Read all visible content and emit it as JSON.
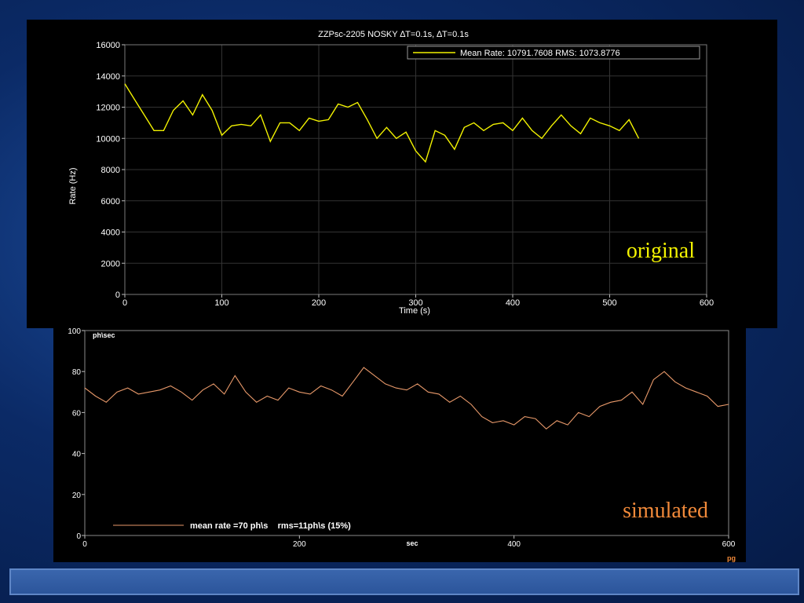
{
  "slide": {
    "background_color": "#0b2a66",
    "footer_bar_color": "#2c559b"
  },
  "chart_data": [
    {
      "type": "line",
      "title": "ZZPsc-2205 NOSKY ∆T=0.1s, ∆T=0.1s",
      "xlabel": "Time (s)",
      "ylabel": "Rate (Hz)",
      "xlim": [
        0,
        600
      ],
      "ylim": [
        0,
        16000
      ],
      "x_ticks": [
        0,
        100,
        200,
        300,
        400,
        500,
        600
      ],
      "y_ticks": [
        0,
        2000,
        4000,
        6000,
        8000,
        10000,
        12000,
        14000,
        16000
      ],
      "grid": true,
      "legend_position": "top-right",
      "legend": "Mean Rate: 10791.7608 RMS: 1073.8776",
      "annotation": "original",
      "line_color": "#f2f200",
      "annotation_color": "#f2f200",
      "series": [
        {
          "x": [
            0,
            10,
            20,
            30,
            40,
            50,
            60,
            70,
            80,
            90,
            100,
            110,
            120,
            130,
            140,
            150,
            160,
            170,
            180,
            190,
            200,
            210,
            220,
            230,
            240,
            250,
            260,
            270,
            280,
            290,
            300,
            310,
            320,
            330,
            340,
            350,
            360,
            370,
            380,
            390,
            400,
            410,
            420,
            430,
            440,
            450,
            460,
            470,
            480,
            490,
            500,
            510,
            520,
            530
          ],
          "values": [
            13500,
            12500,
            11500,
            10500,
            10500,
            11800,
            12400,
            11500,
            12800,
            11800,
            10200,
            10800,
            10900,
            10800,
            11500,
            9800,
            11000,
            11000,
            10500,
            11300,
            11100,
            11200,
            12200,
            12000,
            12300,
            11200,
            10000,
            10700,
            10000,
            10400,
            9200,
            8500,
            10500,
            10200,
            9300,
            10700,
            11000,
            10500,
            10900,
            11000,
            10500,
            11300,
            10500,
            10000,
            10800,
            11500,
            10800,
            10300,
            11300,
            11000,
            10800,
            10500,
            11200,
            10000
          ]
        }
      ]
    },
    {
      "type": "line",
      "title": "",
      "xlabel": "sec",
      "ylabel": "",
      "unit_label": "ph\\sec",
      "corner_label": "pg",
      "xlim": [
        0,
        600
      ],
      "ylim": [
        0,
        100
      ],
      "x_ticks": [
        0,
        200,
        400,
        600
      ],
      "y_ticks": [
        0,
        20,
        40,
        60,
        80,
        100
      ],
      "grid": false,
      "legend_position": "bottom-left",
      "legend": "mean rate =70 ph\\s    rms=11ph\\s (15%)",
      "annotation": "simulated",
      "line_color": "#e8996a",
      "annotation_color": "#f28a3a",
      "series": [
        {
          "x": [
            0,
            10,
            20,
            30,
            40,
            50,
            60,
            70,
            80,
            90,
            100,
            110,
            120,
            130,
            140,
            150,
            160,
            170,
            180,
            190,
            200,
            210,
            220,
            230,
            240,
            250,
            260,
            270,
            280,
            290,
            300,
            310,
            320,
            330,
            340,
            350,
            360,
            370,
            380,
            390,
            400,
            410,
            420,
            430,
            440,
            450,
            460,
            470,
            480,
            490,
            500,
            510,
            520,
            530,
            540,
            550,
            560,
            570,
            580,
            590,
            600
          ],
          "values": [
            72,
            68,
            65,
            70,
            72,
            69,
            70,
            71,
            73,
            70,
            66,
            71,
            74,
            69,
            78,
            70,
            65,
            68,
            66,
            72,
            70,
            69,
            73,
            71,
            68,
            75,
            82,
            78,
            74,
            72,
            71,
            74,
            70,
            69,
            65,
            68,
            64,
            58,
            55,
            56,
            54,
            58,
            57,
            52,
            56,
            54,
            60,
            58,
            63,
            65,
            66,
            70,
            64,
            76,
            80,
            75,
            72,
            70,
            68,
            63,
            64
          ]
        }
      ]
    }
  ]
}
